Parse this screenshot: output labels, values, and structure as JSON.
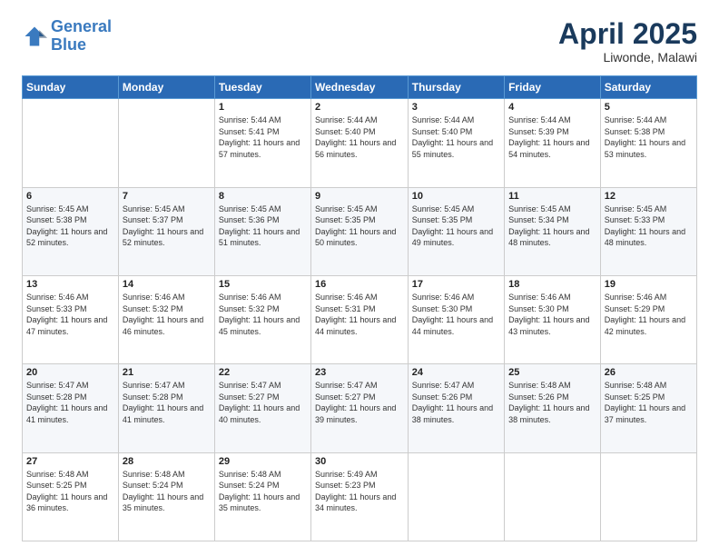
{
  "logo": {
    "line1": "General",
    "line2": "Blue"
  },
  "title": "April 2025",
  "subtitle": "Liwonde, Malawi",
  "weekdays": [
    "Sunday",
    "Monday",
    "Tuesday",
    "Wednesday",
    "Thursday",
    "Friday",
    "Saturday"
  ],
  "weeks": [
    [
      {
        "day": "",
        "detail": ""
      },
      {
        "day": "",
        "detail": ""
      },
      {
        "day": "1",
        "detail": "Sunrise: 5:44 AM\nSunset: 5:41 PM\nDaylight: 11 hours and 57 minutes."
      },
      {
        "day": "2",
        "detail": "Sunrise: 5:44 AM\nSunset: 5:40 PM\nDaylight: 11 hours and 56 minutes."
      },
      {
        "day": "3",
        "detail": "Sunrise: 5:44 AM\nSunset: 5:40 PM\nDaylight: 11 hours and 55 minutes."
      },
      {
        "day": "4",
        "detail": "Sunrise: 5:44 AM\nSunset: 5:39 PM\nDaylight: 11 hours and 54 minutes."
      },
      {
        "day": "5",
        "detail": "Sunrise: 5:44 AM\nSunset: 5:38 PM\nDaylight: 11 hours and 53 minutes."
      }
    ],
    [
      {
        "day": "6",
        "detail": "Sunrise: 5:45 AM\nSunset: 5:38 PM\nDaylight: 11 hours and 52 minutes."
      },
      {
        "day": "7",
        "detail": "Sunrise: 5:45 AM\nSunset: 5:37 PM\nDaylight: 11 hours and 52 minutes."
      },
      {
        "day": "8",
        "detail": "Sunrise: 5:45 AM\nSunset: 5:36 PM\nDaylight: 11 hours and 51 minutes."
      },
      {
        "day": "9",
        "detail": "Sunrise: 5:45 AM\nSunset: 5:35 PM\nDaylight: 11 hours and 50 minutes."
      },
      {
        "day": "10",
        "detail": "Sunrise: 5:45 AM\nSunset: 5:35 PM\nDaylight: 11 hours and 49 minutes."
      },
      {
        "day": "11",
        "detail": "Sunrise: 5:45 AM\nSunset: 5:34 PM\nDaylight: 11 hours and 48 minutes."
      },
      {
        "day": "12",
        "detail": "Sunrise: 5:45 AM\nSunset: 5:33 PM\nDaylight: 11 hours and 48 minutes."
      }
    ],
    [
      {
        "day": "13",
        "detail": "Sunrise: 5:46 AM\nSunset: 5:33 PM\nDaylight: 11 hours and 47 minutes."
      },
      {
        "day": "14",
        "detail": "Sunrise: 5:46 AM\nSunset: 5:32 PM\nDaylight: 11 hours and 46 minutes."
      },
      {
        "day": "15",
        "detail": "Sunrise: 5:46 AM\nSunset: 5:32 PM\nDaylight: 11 hours and 45 minutes."
      },
      {
        "day": "16",
        "detail": "Sunrise: 5:46 AM\nSunset: 5:31 PM\nDaylight: 11 hours and 44 minutes."
      },
      {
        "day": "17",
        "detail": "Sunrise: 5:46 AM\nSunset: 5:30 PM\nDaylight: 11 hours and 44 minutes."
      },
      {
        "day": "18",
        "detail": "Sunrise: 5:46 AM\nSunset: 5:30 PM\nDaylight: 11 hours and 43 minutes."
      },
      {
        "day": "19",
        "detail": "Sunrise: 5:46 AM\nSunset: 5:29 PM\nDaylight: 11 hours and 42 minutes."
      }
    ],
    [
      {
        "day": "20",
        "detail": "Sunrise: 5:47 AM\nSunset: 5:28 PM\nDaylight: 11 hours and 41 minutes."
      },
      {
        "day": "21",
        "detail": "Sunrise: 5:47 AM\nSunset: 5:28 PM\nDaylight: 11 hours and 41 minutes."
      },
      {
        "day": "22",
        "detail": "Sunrise: 5:47 AM\nSunset: 5:27 PM\nDaylight: 11 hours and 40 minutes."
      },
      {
        "day": "23",
        "detail": "Sunrise: 5:47 AM\nSunset: 5:27 PM\nDaylight: 11 hours and 39 minutes."
      },
      {
        "day": "24",
        "detail": "Sunrise: 5:47 AM\nSunset: 5:26 PM\nDaylight: 11 hours and 38 minutes."
      },
      {
        "day": "25",
        "detail": "Sunrise: 5:48 AM\nSunset: 5:26 PM\nDaylight: 11 hours and 38 minutes."
      },
      {
        "day": "26",
        "detail": "Sunrise: 5:48 AM\nSunset: 5:25 PM\nDaylight: 11 hours and 37 minutes."
      }
    ],
    [
      {
        "day": "27",
        "detail": "Sunrise: 5:48 AM\nSunset: 5:25 PM\nDaylight: 11 hours and 36 minutes."
      },
      {
        "day": "28",
        "detail": "Sunrise: 5:48 AM\nSunset: 5:24 PM\nDaylight: 11 hours and 35 minutes."
      },
      {
        "day": "29",
        "detail": "Sunrise: 5:48 AM\nSunset: 5:24 PM\nDaylight: 11 hours and 35 minutes."
      },
      {
        "day": "30",
        "detail": "Sunrise: 5:49 AM\nSunset: 5:23 PM\nDaylight: 11 hours and 34 minutes."
      },
      {
        "day": "",
        "detail": ""
      },
      {
        "day": "",
        "detail": ""
      },
      {
        "day": "",
        "detail": ""
      }
    ]
  ]
}
